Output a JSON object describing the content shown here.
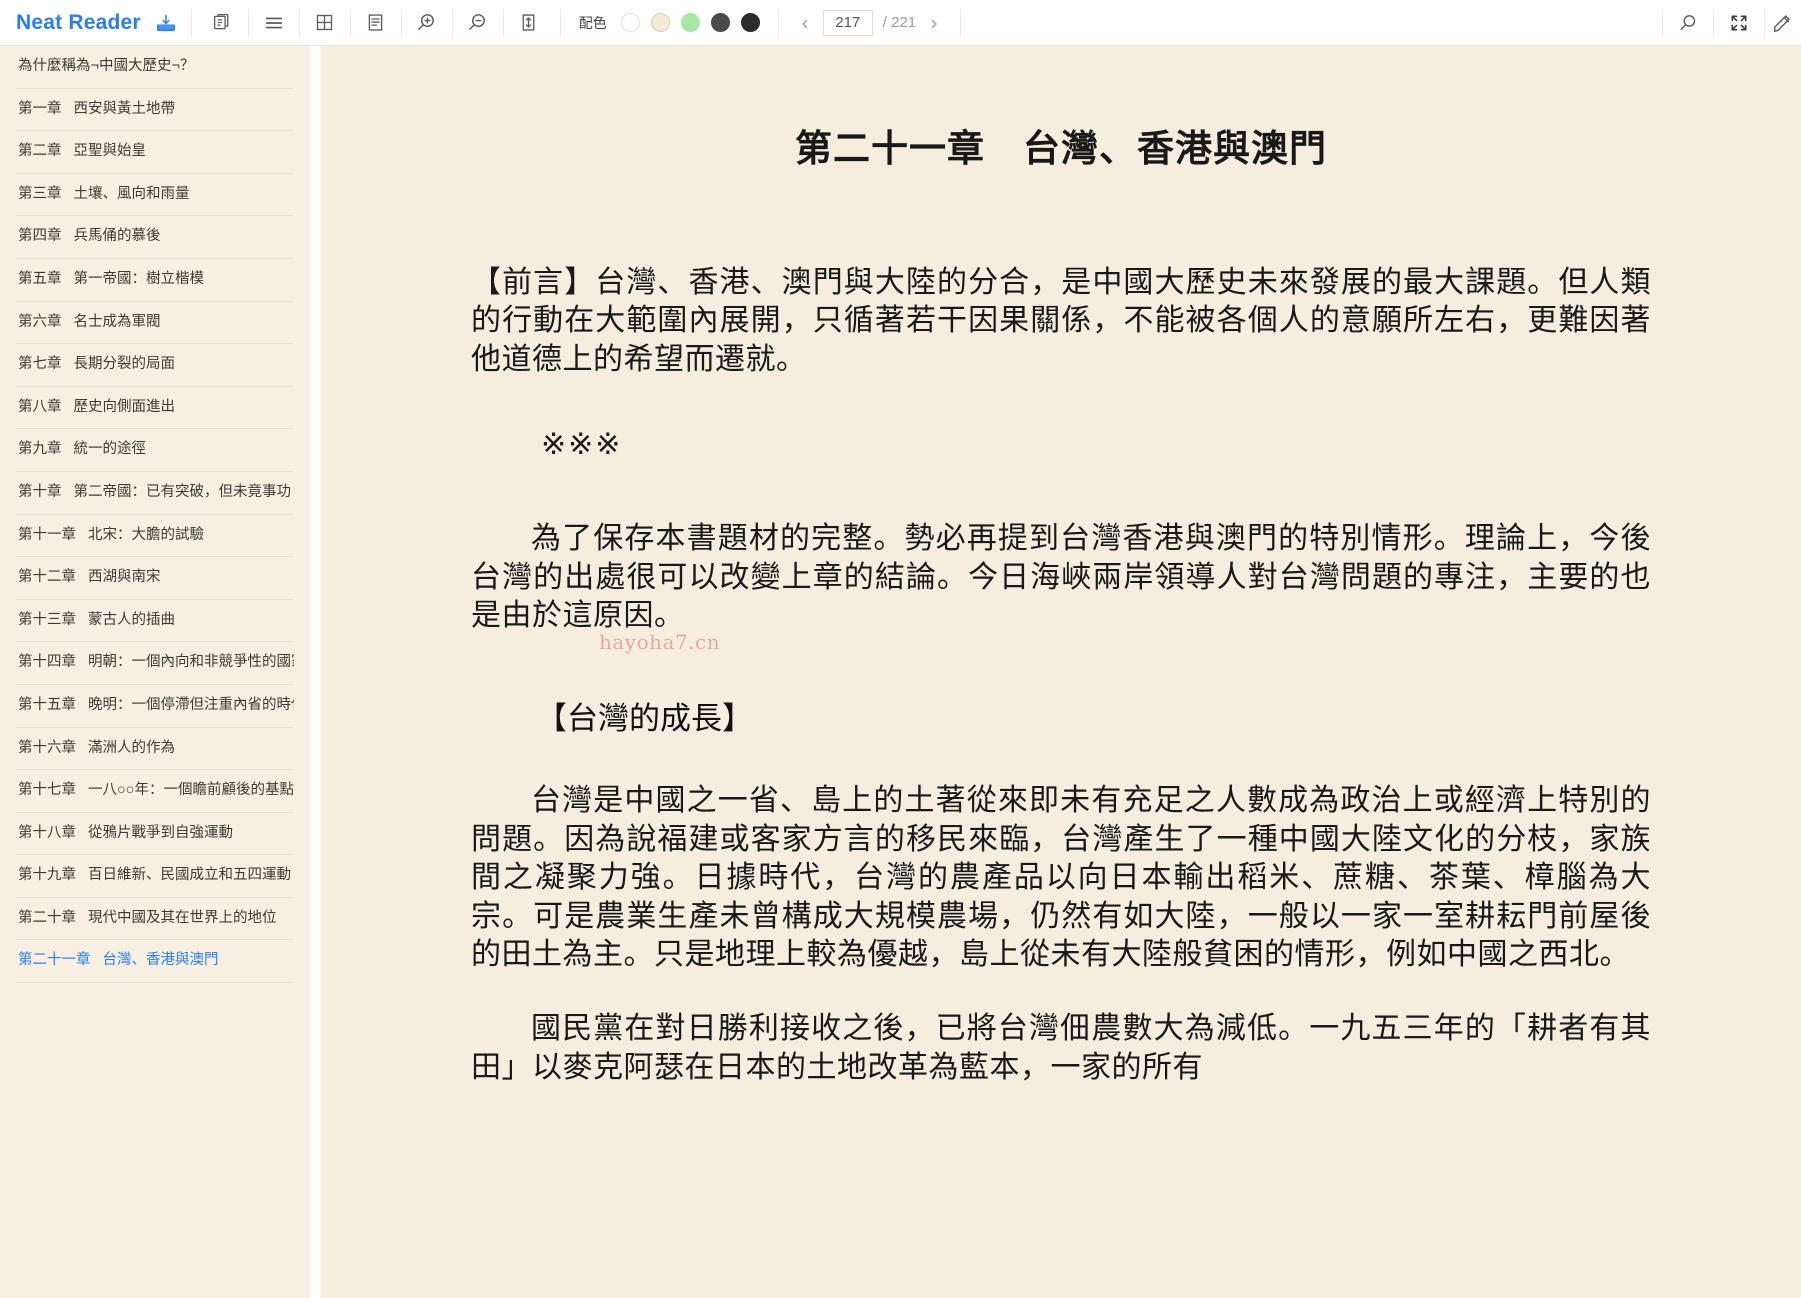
{
  "app": {
    "brand": "Neat Reader"
  },
  "toolbar": {
    "icons": [
      {
        "name": "save-to-library-icon",
        "label": "save-to-library"
      },
      {
        "name": "copy-icon",
        "label": "copy"
      },
      {
        "name": "list-view-icon",
        "label": "list-view"
      },
      {
        "name": "grid-view-icon",
        "label": "grid-view"
      },
      {
        "name": "page-layout-icon",
        "label": "page-layout"
      },
      {
        "name": "zoom-in-icon",
        "label": "zoom-in"
      },
      {
        "name": "zoom-out-icon",
        "label": "zoom-out"
      },
      {
        "name": "fit-height-icon",
        "label": "fit-height"
      }
    ],
    "color_scheme": {
      "label": "配色",
      "swatches": [
        "#ffffff",
        "#f5ead5",
        "#a8e6a3",
        "#4a4a4a",
        "#2b2b2b"
      ],
      "selected_index": 1
    },
    "pager": {
      "prev": "‹",
      "next": "›",
      "current_page": "217",
      "total_label": "/ 221",
      "placeholder": "217"
    },
    "right_icons": [
      {
        "name": "search-icon",
        "label": "search"
      },
      {
        "name": "fullscreen-icon",
        "label": "fullscreen"
      },
      {
        "name": "highlight-pen-icon",
        "label": "highlight-pen"
      }
    ]
  },
  "sidebar": {
    "items": [
      {
        "num": "",
        "title": "為什麼稱為¬中國大歷史¬？",
        "active": false
      },
      {
        "num": "第一章",
        "title": "西安與黃土地帶",
        "active": false
      },
      {
        "num": "第二章",
        "title": "亞聖與始皇",
        "active": false
      },
      {
        "num": "第三章",
        "title": "土壤、風向和雨量",
        "active": false
      },
      {
        "num": "第四章",
        "title": "兵馬俑的慕後",
        "active": false
      },
      {
        "num": "第五章",
        "title": "第一帝國：樹立楷模",
        "active": false
      },
      {
        "num": "第六章",
        "title": "名士成為軍閥",
        "active": false
      },
      {
        "num": "第七章",
        "title": "長期分裂的局面",
        "active": false
      },
      {
        "num": "第八章",
        "title": "歷史向側面進出",
        "active": false
      },
      {
        "num": "第九章",
        "title": "統一的途徑",
        "active": false
      },
      {
        "num": "第十章",
        "title": "第二帝國：已有突破，但未竟事功",
        "active": false
      },
      {
        "num": "第十一章",
        "title": "北宋：大膽的試驗",
        "active": false
      },
      {
        "num": "第十二章",
        "title": "西湖與南宋",
        "active": false
      },
      {
        "num": "第十三章",
        "title": "蒙古人的插曲",
        "active": false
      },
      {
        "num": "第十四章",
        "title": "明朝：一個內向和非競爭性的國家",
        "active": false
      },
      {
        "num": "第十五章",
        "title": "晚明：一個停滯但注重內省的時代",
        "active": false
      },
      {
        "num": "第十六章",
        "title": "滿洲人的作為",
        "active": false
      },
      {
        "num": "第十七章",
        "title": "一八○○年：一個瞻前顧後的基點",
        "active": false
      },
      {
        "num": "第十八章",
        "title": "從鴉片戰爭到自強運動",
        "active": false
      },
      {
        "num": "第十九章",
        "title": "百日維新、民國成立和五四運動",
        "active": false
      },
      {
        "num": "第二十章",
        "title": "現代中國及其在世界上的地位",
        "active": false
      },
      {
        "num": "第二十一章",
        "title": "台灣、香港與澳門",
        "active": true
      }
    ]
  },
  "content": {
    "chapter_title": "第二十一章　台灣、香港與澳門",
    "para_foreword": "【前言】台灣、香港、澳門與大陸的分合，是中國大歷史未來發展的最大課題。但人類的行動在大範圍內展開，只循著若干因果關係，不能被各個人的意願所左右，更難因著他道德上的希望而遷就。",
    "divider_marks": "※※※",
    "para_preserve": "為了保存本書題材的完整。勢必再提到台灣香港與澳門的特別情形。理論上，今後台灣的出處很可以改變上章的結論。今日海峽兩岸領導人對台灣問題的專注，主要的也是由於這原因。",
    "section_heading": "【台灣的成長】",
    "para_taiwan": "台灣是中國之一省、島上的土著從來即未有充足之人數成為政治上或經濟上特別的問題。因為說福建或客家方言的移民來臨，台灣產生了一種中國大陸文化的分枝，家族間之凝聚力強。日據時代，台灣的農產品以向日本輸出稻米、蔗糖、茶葉、樟腦為大宗。可是農業生產未曾構成大規模農場，仍然有如大陸，一般以一家一室耕耘門前屋後的田土為主。只是地理上較為優越，島上從未有大陸般貧困的情形，例如中國之西北。",
    "para_kmt": "國民黨在對日勝利接收之後，已將台灣佃農數大為減低。一九五三年的「耕者有其田」以麥克阿瑟在日本的土地改革為藍本，一家的所有",
    "watermark": "hayoha7.cn"
  }
}
